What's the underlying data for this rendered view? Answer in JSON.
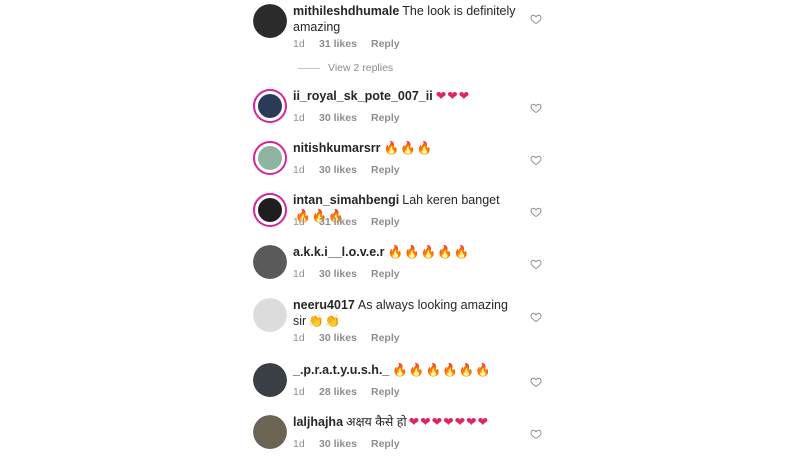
{
  "comments": [
    {
      "username": "mithileshdhumale",
      "text": "The look is definitely amazing",
      "emoji": "",
      "emoji_type": "",
      "time": "1d",
      "likes": "31 likes",
      "reply": "Reply",
      "avatar_color": "#2b2b2b",
      "story_ring": false
    },
    {
      "username": "ii_royal_sk_pote_007_ii",
      "text": "",
      "emoji": "❤❤❤",
      "emoji_type": "heart",
      "time": "1d",
      "likes": "30 likes",
      "reply": "Reply",
      "avatar_color": "#2c3a5a",
      "story_ring": true
    },
    {
      "username": "nitishkumarsrr",
      "text": "",
      "emoji": "🔥🔥🔥",
      "emoji_type": "fire",
      "time": "1d",
      "likes": "30 likes",
      "reply": "Reply",
      "avatar_color": "#8fb3a0",
      "story_ring": true
    },
    {
      "username": "intan_simahbengi",
      "text": "Lah keren banget",
      "emoji": "🔥🔥🔥",
      "emoji_type": "fire",
      "time": "1d",
      "likes": "31 likes",
      "reply": "Reply",
      "avatar_color": "#1e1e1e",
      "story_ring": true
    },
    {
      "username": "a.k.k.i__l.o.v.e.r",
      "text": "",
      "emoji": "🔥🔥🔥🔥🔥",
      "emoji_type": "fire",
      "time": "1d",
      "likes": "30 likes",
      "reply": "Reply",
      "avatar_color": "#5a5a5a",
      "story_ring": false
    },
    {
      "username": "neeru4017",
      "text": "As always looking amazing sir",
      "emoji": "👏👏",
      "emoji_type": "clap",
      "time": "1d",
      "likes": "30 likes",
      "reply": "Reply",
      "avatar_color": "#dcdcdc",
      "story_ring": false
    },
    {
      "username": "_.p.r.a.t.y.u.s.h._",
      "text": "",
      "emoji": "🔥🔥🔥🔥🔥🔥",
      "emoji_type": "fire",
      "time": "1d",
      "likes": "28 likes",
      "reply": "Reply",
      "avatar_color": "#3a3f45",
      "story_ring": false
    },
    {
      "username": "laljhajha",
      "text": "अक्षय कैसे हो",
      "emoji": "❤❤❤❤❤❤❤",
      "emoji_type": "heart",
      "time": "1d",
      "likes": "30 likes",
      "reply": "Reply",
      "avatar_color": "#6b6455",
      "story_ring": false
    }
  ],
  "view_replies": "View 2 replies"
}
